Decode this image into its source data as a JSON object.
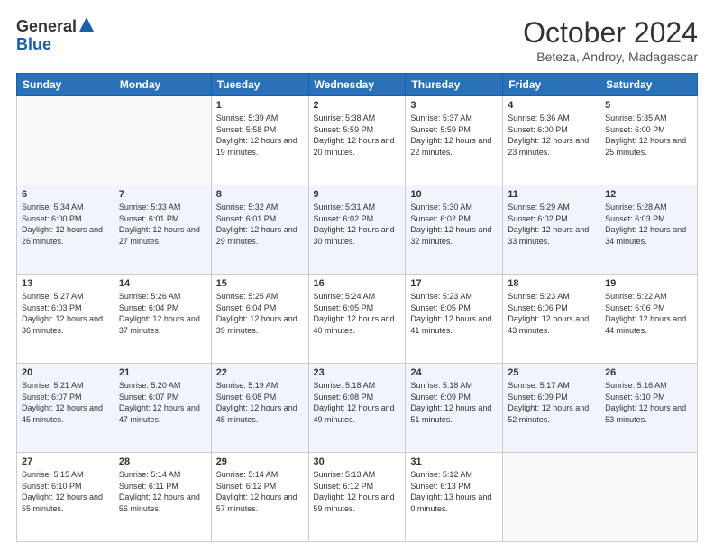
{
  "header": {
    "logo_general": "General",
    "logo_blue": "Blue",
    "month": "October 2024",
    "location": "Beteza, Androy, Madagascar"
  },
  "days_of_week": [
    "Sunday",
    "Monday",
    "Tuesday",
    "Wednesday",
    "Thursday",
    "Friday",
    "Saturday"
  ],
  "weeks": [
    [
      {
        "day": "",
        "info": ""
      },
      {
        "day": "",
        "info": ""
      },
      {
        "day": "1",
        "sunrise": "5:39 AM",
        "sunset": "5:58 PM",
        "daylight": "12 hours and 19 minutes."
      },
      {
        "day": "2",
        "sunrise": "5:38 AM",
        "sunset": "5:59 PM",
        "daylight": "12 hours and 20 minutes."
      },
      {
        "day": "3",
        "sunrise": "5:37 AM",
        "sunset": "5:59 PM",
        "daylight": "12 hours and 22 minutes."
      },
      {
        "day": "4",
        "sunrise": "5:36 AM",
        "sunset": "6:00 PM",
        "daylight": "12 hours and 23 minutes."
      },
      {
        "day": "5",
        "sunrise": "5:35 AM",
        "sunset": "6:00 PM",
        "daylight": "12 hours and 25 minutes."
      }
    ],
    [
      {
        "day": "6",
        "sunrise": "5:34 AM",
        "sunset": "6:00 PM",
        "daylight": "12 hours and 26 minutes."
      },
      {
        "day": "7",
        "sunrise": "5:33 AM",
        "sunset": "6:01 PM",
        "daylight": "12 hours and 27 minutes."
      },
      {
        "day": "8",
        "sunrise": "5:32 AM",
        "sunset": "6:01 PM",
        "daylight": "12 hours and 29 minutes."
      },
      {
        "day": "9",
        "sunrise": "5:31 AM",
        "sunset": "6:02 PM",
        "daylight": "12 hours and 30 minutes."
      },
      {
        "day": "10",
        "sunrise": "5:30 AM",
        "sunset": "6:02 PM",
        "daylight": "12 hours and 32 minutes."
      },
      {
        "day": "11",
        "sunrise": "5:29 AM",
        "sunset": "6:02 PM",
        "daylight": "12 hours and 33 minutes."
      },
      {
        "day": "12",
        "sunrise": "5:28 AM",
        "sunset": "6:03 PM",
        "daylight": "12 hours and 34 minutes."
      }
    ],
    [
      {
        "day": "13",
        "sunrise": "5:27 AM",
        "sunset": "6:03 PM",
        "daylight": "12 hours and 36 minutes."
      },
      {
        "day": "14",
        "sunrise": "5:26 AM",
        "sunset": "6:04 PM",
        "daylight": "12 hours and 37 minutes."
      },
      {
        "day": "15",
        "sunrise": "5:25 AM",
        "sunset": "6:04 PM",
        "daylight": "12 hours and 39 minutes."
      },
      {
        "day": "16",
        "sunrise": "5:24 AM",
        "sunset": "6:05 PM",
        "daylight": "12 hours and 40 minutes."
      },
      {
        "day": "17",
        "sunrise": "5:23 AM",
        "sunset": "6:05 PM",
        "daylight": "12 hours and 41 minutes."
      },
      {
        "day": "18",
        "sunrise": "5:23 AM",
        "sunset": "6:06 PM",
        "daylight": "12 hours and 43 minutes."
      },
      {
        "day": "19",
        "sunrise": "5:22 AM",
        "sunset": "6:06 PM",
        "daylight": "12 hours and 44 minutes."
      }
    ],
    [
      {
        "day": "20",
        "sunrise": "5:21 AM",
        "sunset": "6:07 PM",
        "daylight": "12 hours and 45 minutes."
      },
      {
        "day": "21",
        "sunrise": "5:20 AM",
        "sunset": "6:07 PM",
        "daylight": "12 hours and 47 minutes."
      },
      {
        "day": "22",
        "sunrise": "5:19 AM",
        "sunset": "6:08 PM",
        "daylight": "12 hours and 48 minutes."
      },
      {
        "day": "23",
        "sunrise": "5:18 AM",
        "sunset": "6:08 PM",
        "daylight": "12 hours and 49 minutes."
      },
      {
        "day": "24",
        "sunrise": "5:18 AM",
        "sunset": "6:09 PM",
        "daylight": "12 hours and 51 minutes."
      },
      {
        "day": "25",
        "sunrise": "5:17 AM",
        "sunset": "6:09 PM",
        "daylight": "12 hours and 52 minutes."
      },
      {
        "day": "26",
        "sunrise": "5:16 AM",
        "sunset": "6:10 PM",
        "daylight": "12 hours and 53 minutes."
      }
    ],
    [
      {
        "day": "27",
        "sunrise": "5:15 AM",
        "sunset": "6:10 PM",
        "daylight": "12 hours and 55 minutes."
      },
      {
        "day": "28",
        "sunrise": "5:14 AM",
        "sunset": "6:11 PM",
        "daylight": "12 hours and 56 minutes."
      },
      {
        "day": "29",
        "sunrise": "5:14 AM",
        "sunset": "6:12 PM",
        "daylight": "12 hours and 57 minutes."
      },
      {
        "day": "30",
        "sunrise": "5:13 AM",
        "sunset": "6:12 PM",
        "daylight": "12 hours and 59 minutes."
      },
      {
        "day": "31",
        "sunrise": "5:12 AM",
        "sunset": "6:13 PM",
        "daylight": "13 hours and 0 minutes."
      },
      {
        "day": "",
        "info": ""
      },
      {
        "day": "",
        "info": ""
      }
    ]
  ]
}
